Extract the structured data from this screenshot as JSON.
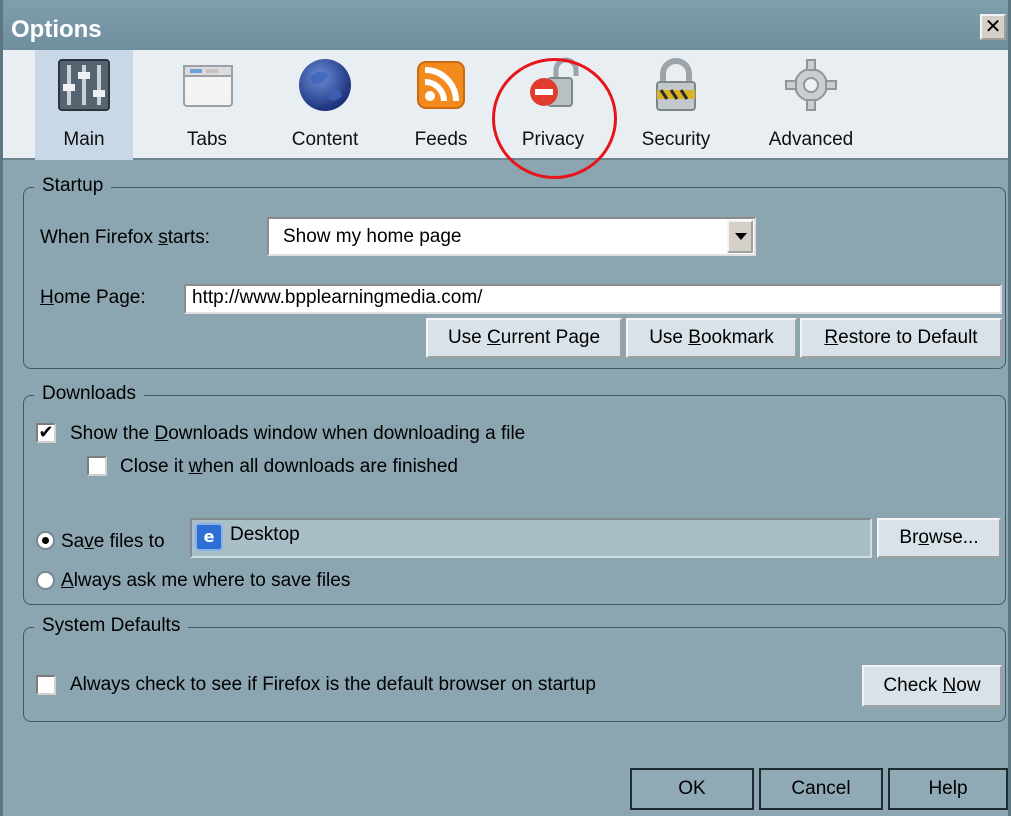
{
  "window": {
    "title": "Options",
    "close_glyph": "✕"
  },
  "toolbar": {
    "tabs": [
      {
        "label": "Main",
        "icon": "main-sliders-icon",
        "selected": true
      },
      {
        "label": "Tabs",
        "icon": "tabs-window-icon"
      },
      {
        "label": "Content",
        "icon": "content-globe-icon"
      },
      {
        "label": "Feeds",
        "icon": "feeds-rss-icon"
      },
      {
        "label": "Privacy",
        "icon": "privacy-lock-icon"
      },
      {
        "label": "Security",
        "icon": "security-padlock-icon"
      },
      {
        "label": "Advanced",
        "icon": "advanced-gear-icon"
      }
    ],
    "highlight_color": "#e8141c"
  },
  "startup": {
    "group_title": "Startup",
    "when_label_pre": "When Firefox ",
    "when_label_key": "s",
    "when_label_post": "tarts:",
    "when_value": "Show my home page",
    "home_label_key": "H",
    "home_label_post": "ome Page:",
    "home_value": "http://www.bpplearningmedia.com/",
    "btn_current_pre": "Use ",
    "btn_current_key": "C",
    "btn_current_post": "urrent Page",
    "btn_bookmark_pre": "Use ",
    "btn_bookmark_key": "B",
    "btn_bookmark_post": "ookmark",
    "btn_restore_key": "R",
    "btn_restore_post": "estore to Default"
  },
  "downloads": {
    "group_title": "Downloads",
    "show_pre": "Show the ",
    "show_key": "D",
    "show_post": "ownloads window when downloading a file",
    "show_checked": true,
    "close_pre": "Close it ",
    "close_key": "w",
    "close_post": "hen all downloads are finished",
    "close_checked": false,
    "save_pre": "Sa",
    "save_key": "v",
    "save_post": "e files to",
    "save_folder": "Desktop",
    "browse_pre": "Br",
    "browse_key": "o",
    "browse_post": "wse...",
    "ask_key": "A",
    "ask_post": "lways ask me where to save files"
  },
  "system_defaults": {
    "group_title": "System Defaults",
    "check_pre": "Always check to see if Firefox is the default browser on startup",
    "check_checked": false,
    "check_now_pre": "Check ",
    "check_now_key": "N",
    "check_now_post": "ow"
  },
  "footer": {
    "ok": "OK",
    "cancel": "Cancel",
    "help": "Help"
  }
}
